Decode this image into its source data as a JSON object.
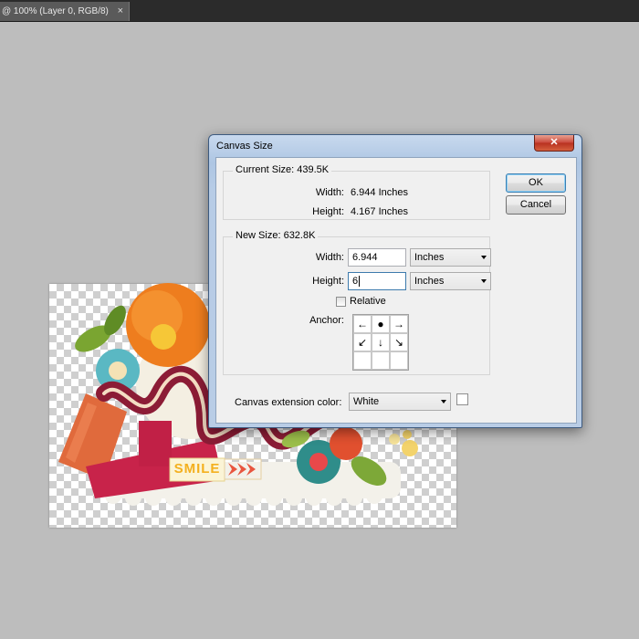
{
  "document_tab": {
    "title": "@ 100% (Layer 0, RGB/8)",
    "close": "×"
  },
  "artwork": {
    "text": "SMILE"
  },
  "dialog": {
    "title": "Canvas Size",
    "close": "✕",
    "current_size": {
      "label": "Current Size: 439.5K",
      "width_label": "Width:",
      "width_value": "6.944 Inches",
      "height_label": "Height:",
      "height_value": "4.167 Inches"
    },
    "new_size": {
      "label": "New Size: 632.8K",
      "width_label": "Width:",
      "width_value": "6.944",
      "width_unit": "Inches",
      "height_label": "Height:",
      "height_value": "6",
      "height_unit": "Inches",
      "relative_label": "Relative",
      "relative_checked": false,
      "anchor_label": "Anchor:",
      "anchor_cells": [
        "←",
        "●",
        "→",
        "↙",
        "↓",
        "↘",
        "",
        "",
        ""
      ]
    },
    "extension": {
      "label": "Canvas extension color:",
      "value": "White",
      "swatch_color": "#ffffff"
    },
    "buttons": {
      "ok": "OK",
      "cancel": "Cancel"
    }
  }
}
